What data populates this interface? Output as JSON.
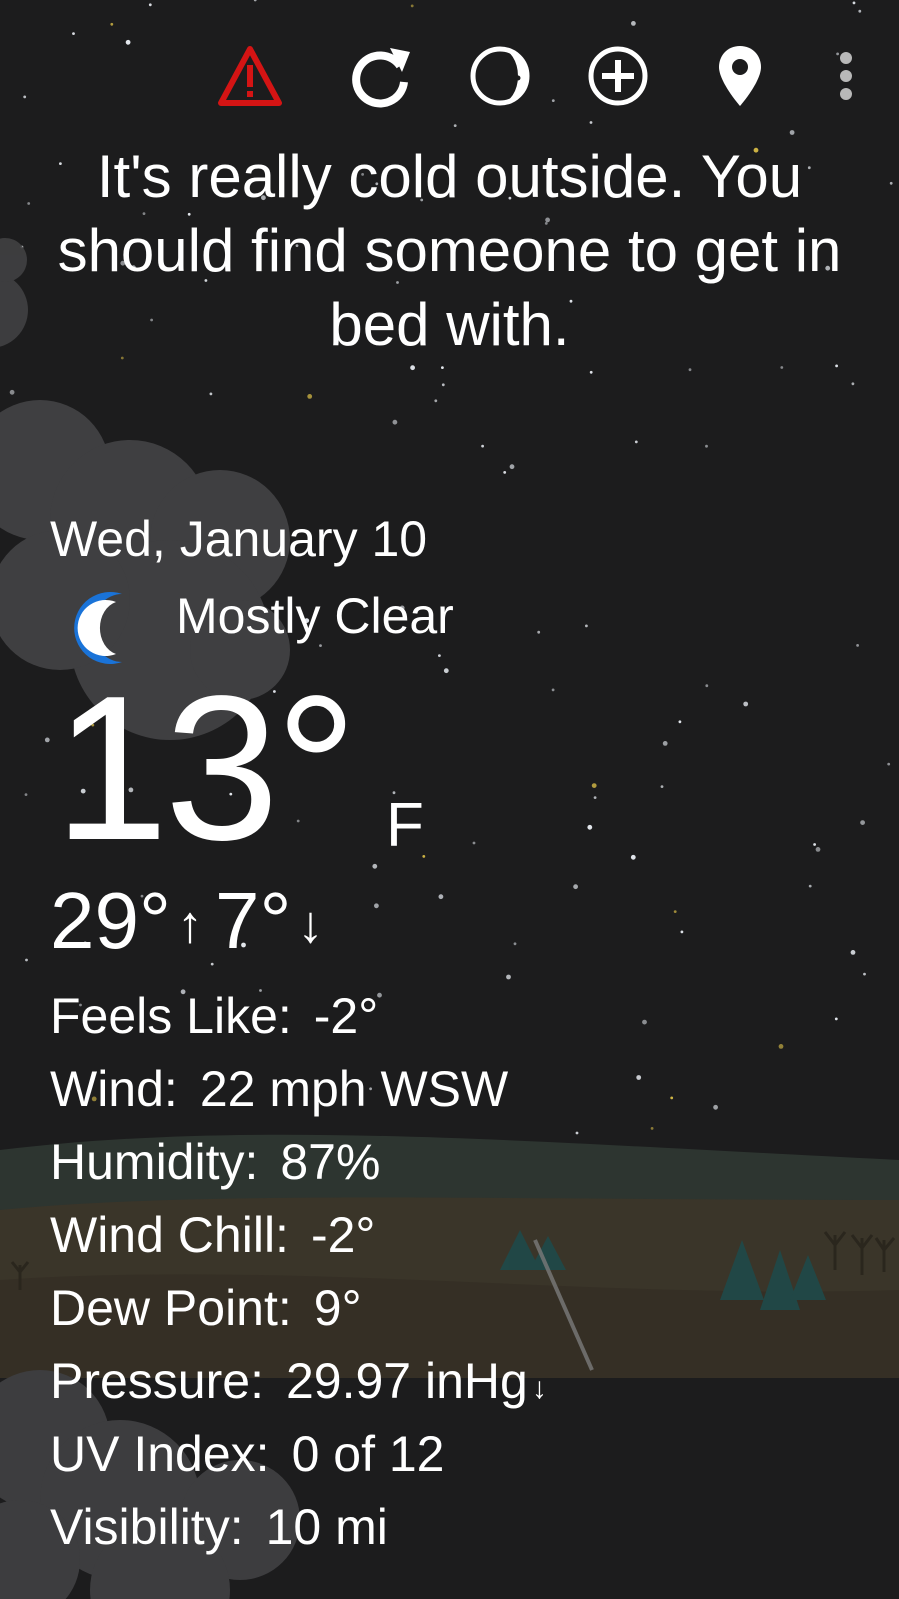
{
  "toolbar": {
    "alert_icon": "warning-triangle-icon",
    "refresh_icon": "refresh-icon",
    "moon_icon": "moon-phase-icon",
    "add_icon": "add-location-icon",
    "location_icon": "location-pin-icon",
    "menu_icon": "overflow-menu-icon",
    "alert_color": "#d41414"
  },
  "message": "It's really cold outside. You should find someone to get in bed with.",
  "current": {
    "date": "Wed, January 10",
    "condition": "Mostly Clear",
    "condition_icon": "crescent-moon-icon",
    "condition_icon_color": "#1a73d8",
    "temperature": "13°",
    "unit": "F",
    "high": "29°",
    "high_arrow": "↑",
    "low": "7°",
    "low_arrow": "↓"
  },
  "details": [
    {
      "label": "Feels Like:",
      "value": "-2°"
    },
    {
      "label": "Wind:",
      "value": "22 mph WSW"
    },
    {
      "label": "Humidity:",
      "value": "87%"
    },
    {
      "label": "Wind Chill:",
      "value": "-2°"
    },
    {
      "label": "Dew Point:",
      "value": "9°"
    },
    {
      "label": "Pressure:",
      "value": "29.97 inHg",
      "trend": "↓"
    },
    {
      "label": "UV Index:",
      "value": "0 of 12"
    },
    {
      "label": "Visibility:",
      "value": "10 mi"
    }
  ],
  "colors": {
    "background": "#1c1c1d",
    "text": "#ffffff",
    "cloud": "#4a4a4c",
    "ground": "#3a3428",
    "hill": "#2f3a33"
  }
}
